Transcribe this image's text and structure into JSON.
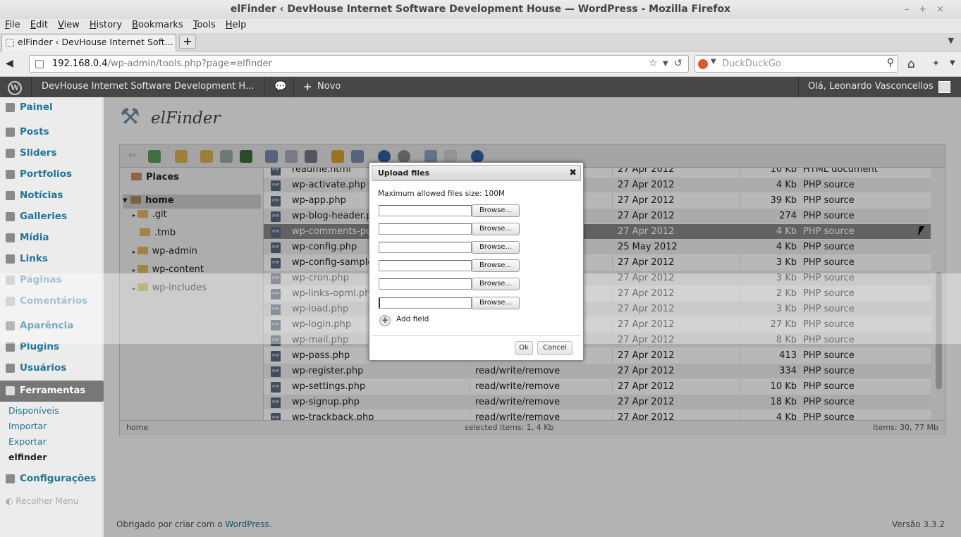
{
  "window": {
    "title": "elFinder ‹ DevHouse Internet Software Development House — WordPress - Mozilla Firefox",
    "controls": "–+×"
  },
  "menu": [
    "File",
    "Edit",
    "View",
    "History",
    "Bookmarks",
    "Tools",
    "Help"
  ],
  "tab": {
    "label": "elFinder ‹ DevHouse Internet Soft...",
    "new_tab": "+"
  },
  "url": {
    "host": "192.168.0.4",
    "path": "/wp-admin/tools.php?page=elfinder"
  },
  "search": {
    "placeholder": "DuckDuckGo"
  },
  "adminbar": {
    "site": "DevHouse Internet Software Development H...",
    "new": "Novo",
    "greeting": "Olá, Leonardo Vasconcellos",
    "wp_logo": "W"
  },
  "sidebar": {
    "items": [
      "Painel",
      "Posts",
      "Sliders",
      "Portfolios",
      "Notícias",
      "Galleries",
      "Mídia",
      "Links",
      "Páginas",
      "Comentários",
      "Aparência",
      "Plugins",
      "Usuários"
    ],
    "current": "Ferramentas",
    "submenu": [
      "Disponíveis",
      "Importar",
      "Exportar",
      "elfinder"
    ],
    "after": "Configurações",
    "collapse": "Recolher Menu"
  },
  "page": {
    "title": "elFinder"
  },
  "tree": {
    "places": "Places",
    "home": "home",
    "folders": [
      ".git",
      ".tmb",
      "wp-admin",
      "wp-content",
      "wp-includes"
    ]
  },
  "files": [
    {
      "name": "readme.html",
      "perm": "",
      "date": "27 Apr 2012",
      "size": "10 Kb",
      "kind": "HTML document"
    },
    {
      "name": "wp-activate.php",
      "perm": "",
      "date": "27 Apr 2012",
      "size": "4 Kb",
      "kind": "PHP source"
    },
    {
      "name": "wp-app.php",
      "perm": "",
      "date": "27 Apr 2012",
      "size": "39 Kb",
      "kind": "PHP source"
    },
    {
      "name": "wp-blog-header.php",
      "perm": "",
      "date": "27 Apr 2012",
      "size": "274",
      "kind": "PHP source"
    },
    {
      "name": "wp-comments-post.php",
      "perm": "",
      "date": "27 Apr 2012",
      "size": "4 Kb",
      "kind": "PHP source"
    },
    {
      "name": "wp-config.php",
      "perm": "",
      "date": "25 May 2012",
      "size": "4 Kb",
      "kind": "PHP source"
    },
    {
      "name": "wp-config-sample.php",
      "perm": "",
      "date": "27 Apr 2012",
      "size": "3 Kb",
      "kind": "PHP source"
    },
    {
      "name": "wp-cron.php",
      "perm": "",
      "date": "27 Apr 2012",
      "size": "3 Kb",
      "kind": "PHP source"
    },
    {
      "name": "wp-links-opml.php",
      "perm": "",
      "date": "27 Apr 2012",
      "size": "2 Kb",
      "kind": "PHP source"
    },
    {
      "name": "wp-load.php",
      "perm": "",
      "date": "27 Apr 2012",
      "size": "3 Kb",
      "kind": "PHP source"
    },
    {
      "name": "wp-login.php",
      "perm": "",
      "date": "27 Apr 2012",
      "size": "27 Kb",
      "kind": "PHP source"
    },
    {
      "name": "wp-mail.php",
      "perm": "",
      "date": "27 Apr 2012",
      "size": "8 Kb",
      "kind": "PHP source"
    },
    {
      "name": "wp-pass.php",
      "perm": "",
      "date": "27 Apr 2012",
      "size": "413",
      "kind": "PHP source"
    },
    {
      "name": "wp-register.php",
      "perm": "read/write/remove",
      "date": "27 Apr 2012",
      "size": "334",
      "kind": "PHP source"
    },
    {
      "name": "wp-settings.php",
      "perm": "read/write/remove",
      "date": "27 Apr 2012",
      "size": "10 Kb",
      "kind": "PHP source"
    },
    {
      "name": "wp-signup.php",
      "perm": "read/write/remove",
      "date": "27 Apr 2012",
      "size": "18 Kb",
      "kind": "PHP source"
    },
    {
      "name": "wp-trackback.php",
      "perm": "read/write/remove",
      "date": "27 Apr 2012",
      "size": "4 Kb",
      "kind": "PHP source"
    }
  ],
  "statusbar": {
    "path": "home",
    "selected": "selected items: 1, 4 Kb",
    "items": "items: 30, 77 Mb"
  },
  "footer": {
    "text": "Obrigado por criar com o ",
    "link": "WordPress",
    "end": ".",
    "version": "Versão 3.3.2"
  },
  "dialog": {
    "title": "Upload files",
    "close": "✖",
    "maxsize": "Maximum allowed files size: 100M",
    "browse": "Browse...",
    "add_field": "Add field",
    "ok": "Ok",
    "cancel": "Cancel"
  }
}
